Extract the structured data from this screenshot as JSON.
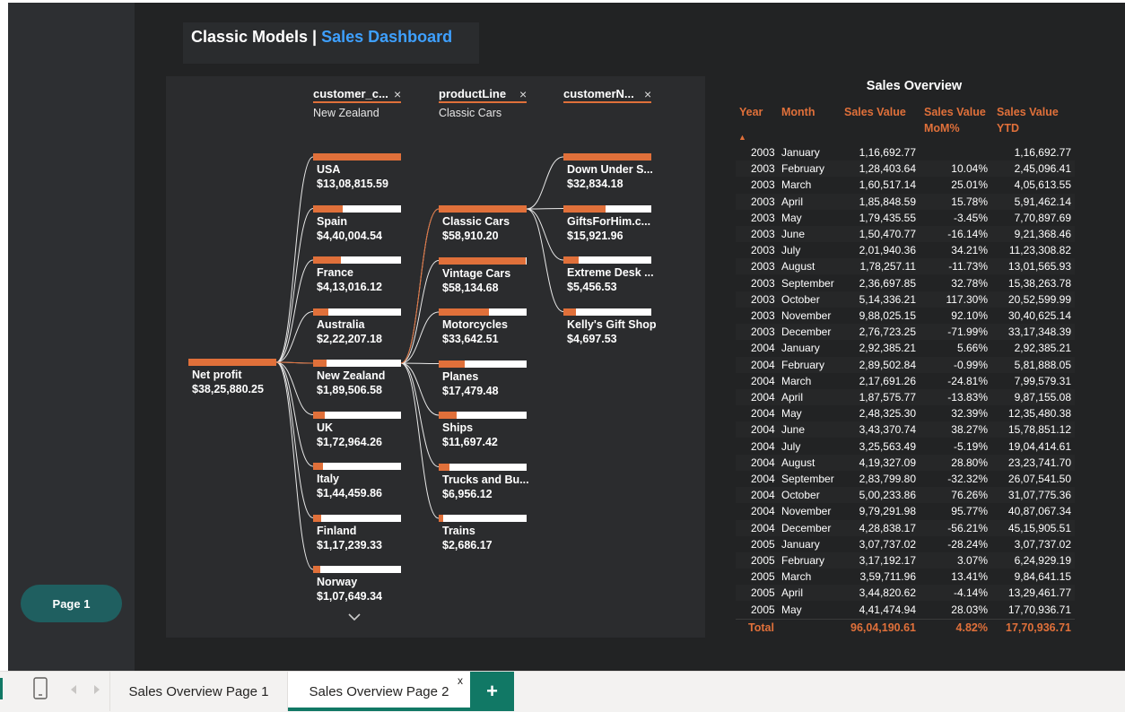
{
  "nav": {
    "page_button": "Page 1"
  },
  "header": {
    "title_main": "Classic Models | ",
    "title_accent": "Sales Dashboard"
  },
  "tree": {
    "levels": [
      {
        "header": "customer_c...",
        "selected": "New Zealand"
      },
      {
        "header": "productLine",
        "selected": "Classic Cars"
      },
      {
        "header": "customerN...",
        "selected": ""
      }
    ],
    "root": {
      "name": "Net profit",
      "value": "$38,25,880.25"
    },
    "countries": [
      {
        "name": "USA",
        "value": "$13,08,815.59",
        "fill": 1.0
      },
      {
        "name": "Spain",
        "value": "$4,40,004.54",
        "fill": 0.34
      },
      {
        "name": "France",
        "value": "$4,13,016.12",
        "fill": 0.32
      },
      {
        "name": "Australia",
        "value": "$2,22,207.18",
        "fill": 0.17
      },
      {
        "name": "New Zealand",
        "value": "$1,89,506.58",
        "fill": 0.15
      },
      {
        "name": "UK",
        "value": "$1,72,964.26",
        "fill": 0.13
      },
      {
        "name": "Italy",
        "value": "$1,44,459.86",
        "fill": 0.11
      },
      {
        "name": "Finland",
        "value": "$1,17,239.33",
        "fill": 0.09
      },
      {
        "name": "Norway",
        "value": "$1,07,649.34",
        "fill": 0.08
      }
    ],
    "products": [
      {
        "name": "Classic Cars",
        "value": "$58,910.20",
        "fill": 1.0
      },
      {
        "name": "Vintage Cars",
        "value": "$58,134.68",
        "fill": 0.99
      },
      {
        "name": "Motorcycles",
        "value": "$33,642.51",
        "fill": 0.57
      },
      {
        "name": "Planes",
        "value": "$17,479.48",
        "fill": 0.3
      },
      {
        "name": "Ships",
        "value": "$11,697.42",
        "fill": 0.2
      },
      {
        "name": "Trucks and Bu...",
        "value": "$6,956.12",
        "fill": 0.12
      },
      {
        "name": "Trains",
        "value": "$2,686.17",
        "fill": 0.05
      }
    ],
    "customers": [
      {
        "name": "Down Under S...",
        "value": "$32,834.18",
        "fill": 1.0
      },
      {
        "name": "GiftsForHim.c...",
        "value": "$15,921.96",
        "fill": 0.48
      },
      {
        "name": "Extreme Desk ...",
        "value": "$5,456.53",
        "fill": 0.17
      },
      {
        "name": "Kelly's Gift Shop",
        "value": "$4,697.53",
        "fill": 0.14
      }
    ]
  },
  "table": {
    "title": "Sales Overview",
    "headers": {
      "year": "Year",
      "month": "Month",
      "sales": "Sales Value",
      "mom": "Sales Value MoM%",
      "ytd": "Sales Value YTD"
    },
    "sort_indicator": "▲",
    "rows": [
      [
        "2003",
        "January",
        "1,16,692.77",
        "",
        "1,16,692.77"
      ],
      [
        "2003",
        "February",
        "1,28,403.64",
        "10.04%",
        "2,45,096.41"
      ],
      [
        "2003",
        "March",
        "1,60,517.14",
        "25.01%",
        "4,05,613.55"
      ],
      [
        "2003",
        "April",
        "1,85,848.59",
        "15.78%",
        "5,91,462.14"
      ],
      [
        "2003",
        "May",
        "1,79,435.55",
        "-3.45%",
        "7,70,897.69"
      ],
      [
        "2003",
        "June",
        "1,50,470.77",
        "-16.14%",
        "9,21,368.46"
      ],
      [
        "2003",
        "July",
        "2,01,940.36",
        "34.21%",
        "11,23,308.82"
      ],
      [
        "2003",
        "August",
        "1,78,257.11",
        "-11.73%",
        "13,01,565.93"
      ],
      [
        "2003",
        "September",
        "2,36,697.85",
        "32.78%",
        "15,38,263.78"
      ],
      [
        "2003",
        "October",
        "5,14,336.21",
        "117.30%",
        "20,52,599.99"
      ],
      [
        "2003",
        "November",
        "9,88,025.15",
        "92.10%",
        "30,40,625.14"
      ],
      [
        "2003",
        "December",
        "2,76,723.25",
        "-71.99%",
        "33,17,348.39"
      ],
      [
        "2004",
        "January",
        "2,92,385.21",
        "5.66%",
        "2,92,385.21"
      ],
      [
        "2004",
        "February",
        "2,89,502.84",
        "-0.99%",
        "5,81,888.05"
      ],
      [
        "2004",
        "March",
        "2,17,691.26",
        "-24.81%",
        "7,99,579.31"
      ],
      [
        "2004",
        "April",
        "1,87,575.77",
        "-13.83%",
        "9,87,155.08"
      ],
      [
        "2004",
        "May",
        "2,48,325.30",
        "32.39%",
        "12,35,480.38"
      ],
      [
        "2004",
        "June",
        "3,43,370.74",
        "38.27%",
        "15,78,851.12"
      ],
      [
        "2004",
        "July",
        "3,25,563.49",
        "-5.19%",
        "19,04,414.61"
      ],
      [
        "2004",
        "August",
        "4,19,327.09",
        "28.80%",
        "23,23,741.70"
      ],
      [
        "2004",
        "September",
        "2,83,799.80",
        "-32.32%",
        "26,07,541.50"
      ],
      [
        "2004",
        "October",
        "5,00,233.86",
        "76.26%",
        "31,07,775.36"
      ],
      [
        "2004",
        "November",
        "9,79,291.98",
        "95.77%",
        "40,87,067.34"
      ],
      [
        "2004",
        "December",
        "4,28,838.17",
        "-56.21%",
        "45,15,905.51"
      ],
      [
        "2005",
        "January",
        "3,07,737.02",
        "-28.24%",
        "3,07,737.02"
      ],
      [
        "2005",
        "February",
        "3,17,192.17",
        "3.07%",
        "6,24,929.19"
      ],
      [
        "2005",
        "March",
        "3,59,711.96",
        "13.41%",
        "9,84,641.15"
      ],
      [
        "2005",
        "April",
        "3,44,820.62",
        "-4.14%",
        "13,29,461.77"
      ],
      [
        "2005",
        "May",
        "4,41,474.94",
        "28.03%",
        "17,70,936.71"
      ]
    ],
    "total": {
      "label": "Total",
      "sales": "96,04,190.61",
      "mom": "4.82%",
      "ytd": "17,70,936.71"
    }
  },
  "tabs": {
    "page1": "Sales Overview Page 1",
    "page2": "Sales Overview Page 2",
    "close": "x",
    "add": "+"
  },
  "colors": {
    "accent": "#e0703a",
    "title_accent": "#3ea0ff",
    "tab_active": "#117865"
  }
}
